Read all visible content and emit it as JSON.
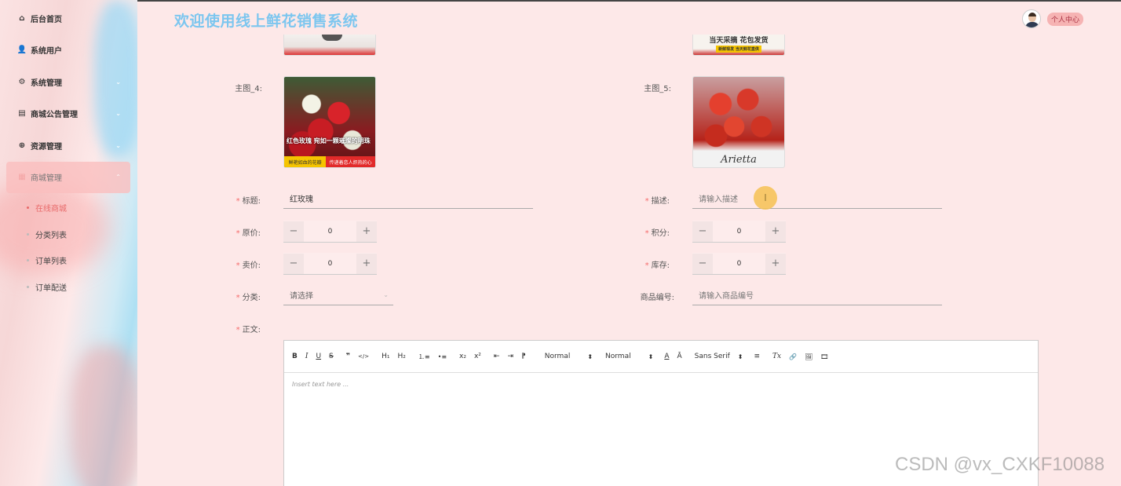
{
  "header": {
    "title": "欢迎使用线上鲜花销售系统",
    "user_center": "个人中心"
  },
  "sidebar": {
    "items": [
      {
        "label": "后台首页",
        "icon": "home-icon",
        "glyph": "⌂"
      },
      {
        "label": "系统用户",
        "icon": "user-icon",
        "glyph": "👤"
      },
      {
        "label": "系统管理",
        "icon": "gear-icon",
        "glyph": "⚙"
      },
      {
        "label": "商城公告管理",
        "icon": "document-icon",
        "glyph": "▤"
      },
      {
        "label": "资源管理",
        "icon": "plus-circle-icon",
        "glyph": "⊕"
      },
      {
        "label": "商城管理",
        "icon": "grid-icon",
        "glyph": "▦"
      }
    ],
    "submenu": [
      {
        "label": "在线商城",
        "active": true
      },
      {
        "label": "分类列表",
        "active": false
      },
      {
        "label": "订单列表",
        "active": false
      },
      {
        "label": "订单配送",
        "active": false
      }
    ]
  },
  "form": {
    "main_image_4_label": "主图_4:",
    "main_image_5_label": "主图_5:",
    "image4_text": "红色玫瑰 宛如一颗璀璨的明珠",
    "image4_caption_left": "鲜艳如血的花瓣",
    "image4_caption_right": "传递着恋人炽热的心",
    "image5_text": "Arietta",
    "top_image_right_text": "当天采摘 花包发货",
    "top_image_right_sub": "新鲜现发 当天鲜花直供",
    "title_label": "标题:",
    "title_value": "红玫瑰",
    "desc_label": "描述:",
    "desc_placeholder": "请输入描述",
    "original_price_label": "原价:",
    "original_price_value": "0",
    "points_label": "积分:",
    "points_value": "0",
    "sale_price_label": "卖价:",
    "sale_price_value": "0",
    "stock_label": "库存:",
    "stock_value": "0",
    "category_label": "分类:",
    "category_placeholder": "请选择",
    "product_code_label": "商品编号:",
    "product_code_placeholder": "请输入商品编号",
    "body_label": "正文:",
    "required_mark": "*",
    "minus": "−",
    "plus": "+"
  },
  "editor": {
    "bold": "B",
    "italic": "I",
    "underline": "U",
    "strike": "S",
    "quote": "❞",
    "code": "</>",
    "h1": "H₁",
    "h2": "H₂",
    "ordered_list": "⒈≡",
    "bullet_list": "•≡",
    "subscript": "x₂",
    "superscript": "x²",
    "outdent": "⇤",
    "indent": "⇥",
    "rtl": "⁋",
    "size_select": "Normal",
    "header_select": "Normal",
    "color": "A",
    "background": "Ā",
    "font_select": "Sans Serif",
    "align": "≡",
    "clean": "Tx",
    "link": "🔗",
    "image": "🖼",
    "video": "🎞",
    "placeholder": "Insert text here ..."
  },
  "watermark": "CSDN @vx_CXKF10088",
  "cursor_glyph": "I"
}
